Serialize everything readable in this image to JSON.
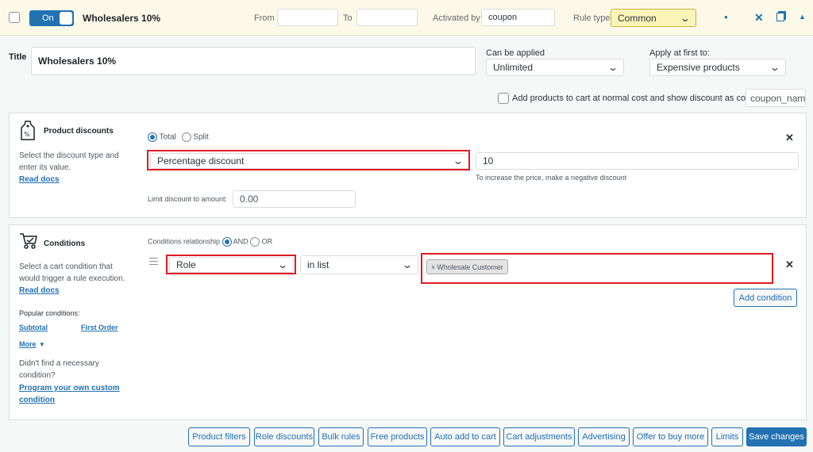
{
  "header": {
    "toggle_label": "On",
    "rule_name": "Wholesalers 10%",
    "from_label": "From",
    "to_label": "To",
    "activated_by_label": "Activated by",
    "activated_by_value": "coupon",
    "rule_type_label": "Rule type",
    "rule_type_value": "Common",
    "icons": [
      "pin-icon",
      "close-icon",
      "copy-icon",
      "collapse-icon"
    ]
  },
  "rule": {
    "title_label": "Title",
    "title_value": "Wholesalers 10%",
    "can_be_applied_label": "Can be applied",
    "can_be_applied_value": "Unlimited",
    "apply_first_label": "Apply at first to:",
    "apply_first_value": "Expensive products",
    "coupon_checkbox_label": "Add products to cart at normal cost and show discount as coupon",
    "coupon_name_placeholder": "coupon_name"
  },
  "product_discounts": {
    "heading": "Product discounts",
    "description": "Select the discount type and enter its value.",
    "docs_link": "Read docs",
    "radio_total": "Total",
    "radio_split": "Split",
    "discount_type": "Percentage discount",
    "discount_value": "10",
    "hint": "To increase the price, make a negative discount",
    "limit_label": "Limit discount to amount:",
    "limit_placeholder": "0.00"
  },
  "conditions": {
    "heading": "Conditions",
    "description": "Select a cart condition that would trigger a rule execution.",
    "docs_link": "Read docs",
    "relationship_label": "Conditions relationship",
    "radio_and": "AND",
    "radio_or": "OR",
    "condition_type": "Role",
    "operator": "in list",
    "tag_remove": "×",
    "tag": "Wholesale Customer",
    "add_button": "Add condition",
    "popular_label": "Popular conditions:",
    "popular_subtotal": "Subtotal",
    "popular_first_order": "First Order",
    "more_link": "More",
    "not_found_text": "Didn't find a necessary condition?",
    "custom_link": "Program your own custom condition"
  },
  "footer_buttons": [
    "Product filters",
    "Role discounts",
    "Bulk rules",
    "Free products",
    "Auto add to cart",
    "Cart adjustments",
    "Advertising",
    "Offer to buy more",
    "Limits"
  ],
  "save_button": "Save changes",
  "colors": {
    "accent": "#2271b1",
    "highlight": "#e01b24",
    "header_bg": "#fcf9e8",
    "rule_type_bg": "#fcf5b8"
  }
}
